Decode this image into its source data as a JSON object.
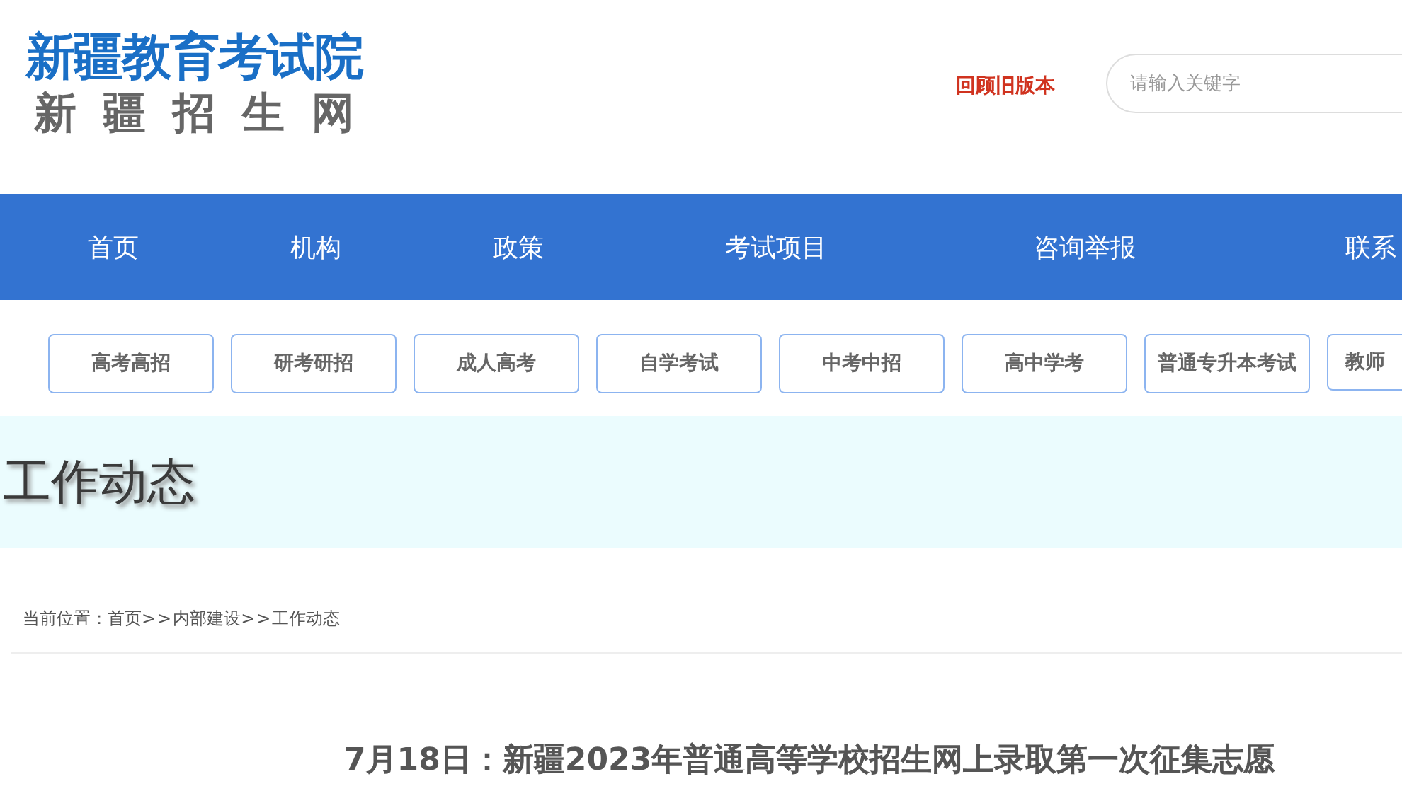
{
  "header": {
    "logo_title": "新疆教育考试院",
    "logo_subtitle": "新疆招生网",
    "old_version_link": "回顾旧版本",
    "search": {
      "placeholder": "请输入关键字"
    }
  },
  "nav": [
    {
      "label": "首页"
    },
    {
      "label": "机构"
    },
    {
      "label": "政策"
    },
    {
      "label": "考试项目"
    },
    {
      "label": "咨询举报"
    },
    {
      "label": "联系"
    }
  ],
  "categories": [
    "高考高招",
    "研考研招",
    "成人高考",
    "自学考试",
    "中考中招",
    "高中学考",
    "普通专升本考试",
    "教师"
  ],
  "banner": {
    "title": "工作动态"
  },
  "breadcrumb": {
    "label": "当前位置：",
    "separator": ">>",
    "items": [
      "首页",
      "内部建设",
      "工作动态"
    ]
  },
  "article": {
    "title": "7月18日：新疆2023年普通高等学校招生网上录取第一次征集志愿"
  }
}
